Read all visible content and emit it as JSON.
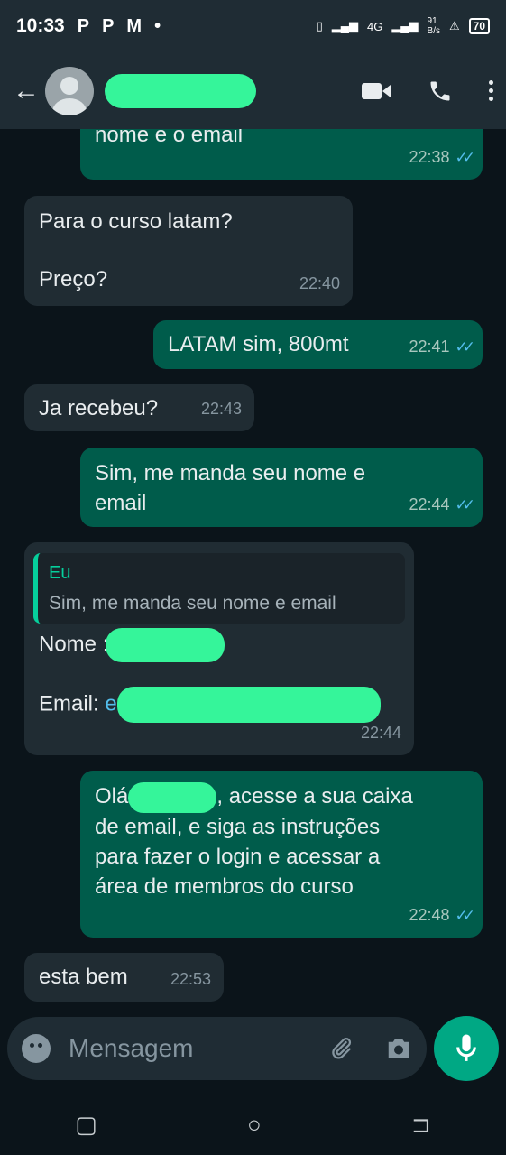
{
  "statusbar": {
    "time": "10:33",
    "app_icons": [
      "P",
      "P",
      "M",
      "•"
    ],
    "net_speed_top": "91",
    "net_speed_unit": "B/s",
    "network": "4G",
    "battery": "70"
  },
  "header": {
    "back_icon": "arrow-back-icon",
    "video_icon": "video-call-icon",
    "call_icon": "phone-call-icon",
    "menu_icon": "more-vert-icon"
  },
  "messages": [
    {
      "dir": "out",
      "text": "manda o comprovante, seu nome e o email",
      "visible_text": "nome e o email",
      "time": "22:38"
    },
    {
      "dir": "in",
      "line1": "Para o curso latam?",
      "line2": "Preço?",
      "time": "22:40"
    },
    {
      "dir": "out",
      "text": "LATAM sim, 800mt",
      "time": "22:41"
    },
    {
      "dir": "in",
      "text": "Ja recebeu?",
      "time": "22:43"
    },
    {
      "dir": "out",
      "line1": "Sim, me manda seu nome e",
      "line2": "email",
      "time": "22:44"
    },
    {
      "dir": "in",
      "reply_author": "Eu",
      "reply_text": "Sim, me manda seu nome e email",
      "line1": "Nome : ",
      "line2": "Email: ",
      "email_prefix": "e",
      "time": "22:44"
    },
    {
      "dir": "out",
      "prefix": "Olá",
      "rest1": ", acesse a sua caixa",
      "line2": "de email, e siga as instruções",
      "line3": "para fazer o login e acessar a",
      "line4": "área de membros do curso",
      "time": "22:48"
    },
    {
      "dir": "in",
      "text": "esta bem",
      "time": "22:53"
    }
  ],
  "input": {
    "placeholder": "Mensagem"
  }
}
